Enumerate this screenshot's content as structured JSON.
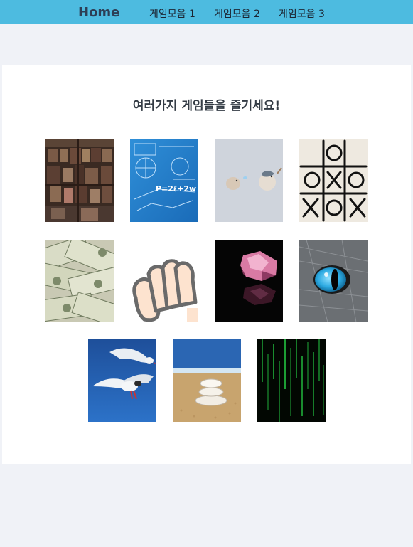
{
  "nav": {
    "home": "Home",
    "menu": [
      "게임모음 1",
      "게임모음 2",
      "게임모음 3"
    ]
  },
  "main": {
    "heading": "여러가지 게임들을 즐기세요!"
  },
  "formula_text": "P=2ℓ+2w",
  "colors": {
    "topbar": "#4dbbe0",
    "page_bg": "#f0f2f7",
    "card_bg": "#ffffff"
  }
}
